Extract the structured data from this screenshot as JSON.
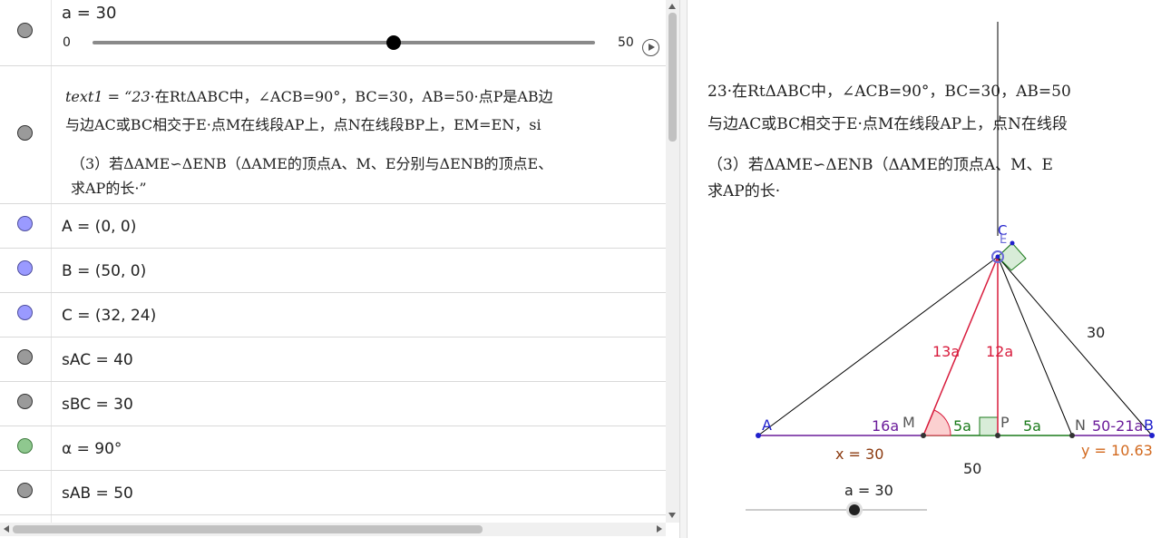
{
  "algebra": {
    "slider": {
      "title": "a = 30",
      "min": "0",
      "max": "50",
      "value": 30,
      "range": [
        0,
        50
      ]
    },
    "text1": {
      "prefix": "text1 = “23",
      "line1": "·在RtΔABC中，∠ACB=90°，BC=30，AB=50·点P是AB边",
      "line2": "与边AC或BC相交于E·点M在线段AP上，点N在线段BP上，EM=EN，si",
      "line3": "（3）若ΔAME∽ΔENB（ΔAME的顶点A、M、E分别与ΔENB的顶点E、",
      "line4": "求AP的长·”"
    },
    "rows": [
      {
        "text": "A = (0, 0)",
        "color": "blue"
      },
      {
        "text": "B = (50, 0)",
        "color": "blue"
      },
      {
        "text": "C = (32, 24)",
        "color": "blue"
      },
      {
        "text": "sAC = 40",
        "color": "gray"
      },
      {
        "text": "sBC = 30",
        "color": "gray"
      },
      {
        "text": "α = 90°",
        "color": "green"
      },
      {
        "text": "sAB = 50",
        "color": "gray"
      }
    ]
  },
  "graphics": {
    "text": {
      "line1": "23·在RtΔABC中，∠ACB=90°，BC=30，AB=50",
      "line2": "与边AC或BC相交于E·点M在线段AP上，点N在线段",
      "line3": "（3）若ΔAME∽ΔENB（ΔAME的顶点A、M、E",
      "line4": "求AP的长·"
    },
    "labels": {
      "A": "A",
      "B": "B",
      "C": "C",
      "E": "E",
      "M": "M",
      "P": "P",
      "N": "N",
      "seg_AM": "16a",
      "seg_MP": "5a",
      "seg_PN": "5a",
      "seg_NB": "50-21a",
      "seg_EM": "13a",
      "seg_EP": "12a",
      "seg_BC": "30",
      "seg_AB": "50",
      "x_value": "x = 30",
      "y_value": "y = 10.63"
    },
    "slider": {
      "label": "a = 30",
      "value": 30,
      "range": [
        0,
        50
      ]
    },
    "colors": {
      "crimson": "#d81b3c",
      "green": "#1a7a1a",
      "purple": "#6a1b9a",
      "brown": "#8b3a0f",
      "orange": "#d2691e",
      "blue_label": "#2020cc",
      "point_dark": "#333333",
      "angle_fill": "#fbd0d0",
      "right_angle_fill": "#d8ecd8"
    }
  }
}
